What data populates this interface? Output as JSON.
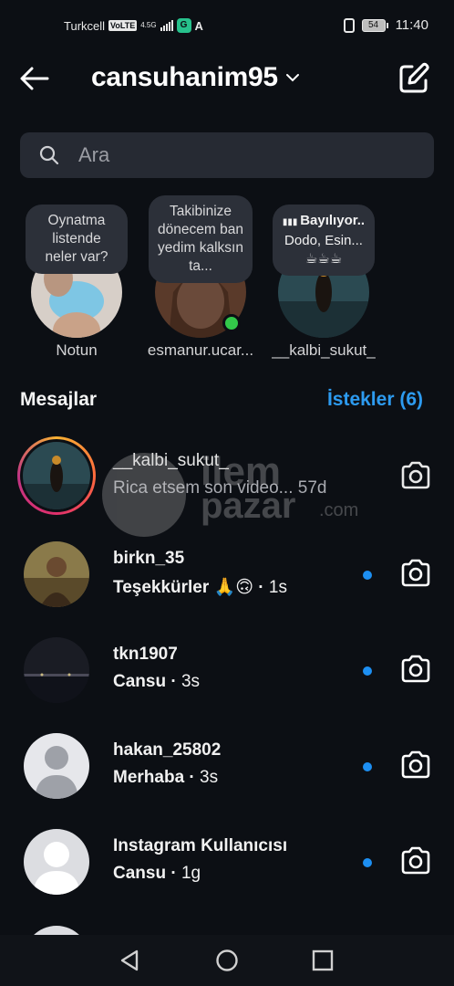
{
  "status_bar": {
    "carrier": "Turkcell",
    "volte": "VoLTE",
    "network": "4.5G",
    "app_badge": "G",
    "battery": "54",
    "time": "11:40"
  },
  "header": {
    "username": "cansuhanim95",
    "back_icon": "arrow-left-icon",
    "compose_icon": "edit-icon"
  },
  "search": {
    "placeholder": "Ara"
  },
  "notes": [
    {
      "text": "Oynatma listende neler var?",
      "name": "Notun"
    },
    {
      "text": "Takibinize dönecem ban yedim kalksın ta...",
      "name": "esmanur.ucar...",
      "online": true
    },
    {
      "text_title": "Bayılıyor..",
      "text": "Dodo, Esin...",
      "emoji": "☕☕☕",
      "name": "__kalbi_sukut_"
    }
  ],
  "messages_section": {
    "title": "Mesajlar",
    "requests": "İstekler (6)"
  },
  "messages": [
    {
      "name": "__kalbi_sukut_",
      "preview": "Rica etsem son video...",
      "time": "57d",
      "unread": false,
      "story_ring": true
    },
    {
      "name": "birkn_35",
      "preview": "Teşekkürler 🙏🙃",
      "time": "1s",
      "unread": true
    },
    {
      "name": "tkn1907",
      "preview": "Cansu",
      "time": "3s",
      "unread": true
    },
    {
      "name": "hakan_25802",
      "preview": "Merhaba",
      "time": "3s",
      "unread": true
    },
    {
      "name": "Instagram Kullanıcısı",
      "preview": "Cansu",
      "time": "1g",
      "unread": true
    }
  ],
  "watermark": {
    "line1": "ilem",
    "line2": "pazar",
    "line3": ".com"
  },
  "colors": {
    "background": "#0c0f14",
    "accent": "#2d9bf0",
    "unread_dot": "#1d8ff2",
    "online": "#33c94a"
  }
}
